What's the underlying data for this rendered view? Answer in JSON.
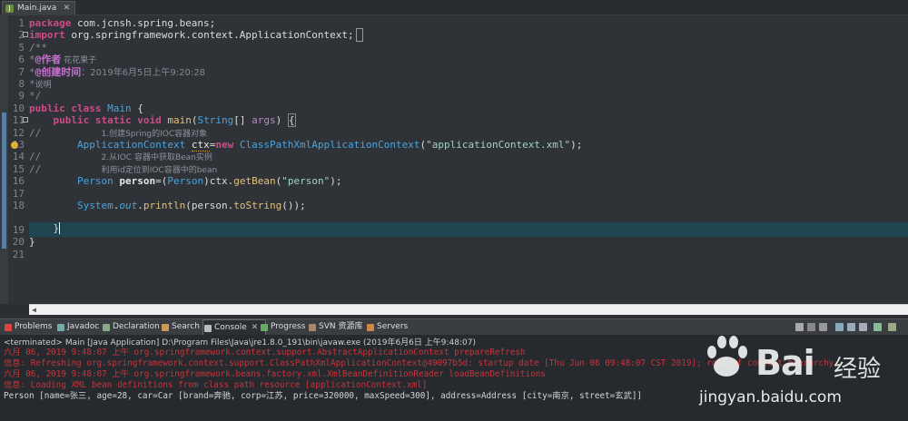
{
  "editor": {
    "tab": "Main.java",
    "lines": [
      "1",
      "2",
      "5",
      "6",
      "7",
      "8",
      "9",
      "10",
      "11",
      "12",
      "13",
      "14",
      "15",
      "16",
      "17",
      "18",
      "19",
      "20",
      "21"
    ]
  },
  "code": {
    "l1_kw": "package",
    "l1_rest": " com.jcnsh.spring.beans;",
    "l2_kw": "import",
    "l2_rest": " org.springframework.context.ApplicationContext;",
    "l3": "/**",
    "l4_a": "*",
    "l4_tag": "@作者",
    "l4_val": " 花花果子",
    "l5_a": "*",
    "l5_tag": "@创建时间",
    "l5_val": "：2019年6月5日上午9:20:28",
    "l6_a": "*",
    "l6_val": "说明",
    "l7": "*/",
    "l8_k1": "public",
    "l8_k2": "class",
    "l8_name": "Main",
    "l9_k1": "public",
    "l9_k2": "static",
    "l9_k3": "void",
    "l9_m": "main",
    "l9_t": "String",
    "l9_p": "args",
    "l10_c": "//",
    "l10_z": "1.创建Spring的IOC容器对象",
    "l11_t": "ApplicationContext",
    "l11_v": "ctx",
    "l11_new": "new",
    "l11_t2": "ClassPathXmlApplicationContext",
    "l11_s": "\"applicationContext.xml\"",
    "l12_c": "//",
    "l12_z": "2.从IOC 容器中获取Bean实例",
    "l13_c": "//",
    "l13_z": "利用id定位到IOC容器中的bean",
    "l14_t": "Person",
    "l14_v": "person",
    "l14_cast": "Person",
    "l14_obj": "ctx",
    "l14_m": "getBean",
    "l14_s": "\"person\"",
    "l15_t": "System",
    "l15_f": "out",
    "l15_m": "println",
    "l15_a": "person",
    "l15_m2": "toString",
    "l16": "}",
    "l17": "}"
  },
  "views": {
    "tabs": [
      "Problems",
      "Javadoc",
      "Declaration",
      "Search",
      "Console",
      "Progress",
      "SVN 资源库",
      "Servers"
    ],
    "close": "✕"
  },
  "console": {
    "terminated": "<terminated> Main [Java Application] D:\\Program Files\\Java\\jre1.8.0_191\\bin\\javaw.exe (2019年6月6日 上午9:48:07)",
    "lines": [
      "六月 06, 2019 9:48:07 上午 org.springframework.context.support.AbstractApplicationContext prepareRefresh",
      "信息: Refreshing org.springframework.context.support.ClassPathXmlApplicationContext@49097b5d: startup date [Thu Jun 06 09:48:07 CST 2019]; root of context hierarchy",
      "六月 06, 2019 9:48:07 上午 org.springframework.beans.factory.xml.XmlBeanDefinitionReader loadBeanDefinitions",
      "信息: Loading XML bean definitions from class path resource [applicationContext.xml]"
    ],
    "output": "Person [name=张三, age=28, car=Car [brand=奔驰, corp=江苏, price=320000, maxSpeed=300], address=Address [city=南京, street=玄武]]"
  },
  "watermark": {
    "brand": "Bai",
    "brand2": "经验",
    "url": "jingyan.baidu.com"
  },
  "colors": {
    "keyword": "#cc4c84",
    "type": "#4aa3df",
    "string": "#9fd3c2",
    "console_red": "#c8333b",
    "current_line": "#1f4550"
  }
}
